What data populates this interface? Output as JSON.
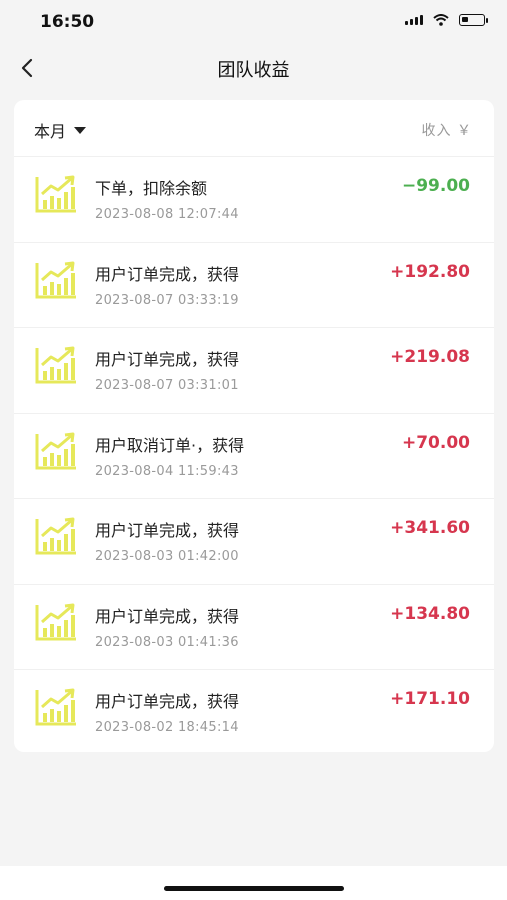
{
  "status": {
    "time": "16:50"
  },
  "nav": {
    "title": "团队收益"
  },
  "filter": {
    "label": "本月"
  },
  "header": {
    "income_label": "收入 ￥"
  },
  "colors": {
    "negative": "#4caf50",
    "positive": "#d6364e",
    "icon": "#e6e85a"
  },
  "rows": [
    {
      "title": "下单，扣除余额",
      "time": "2023-08-08 12:07:44",
      "amount": "−99.00",
      "sign": "negative"
    },
    {
      "title": "用户订单完成，获得",
      "time": "2023-08-07 03:33:19",
      "amount": "+192.80",
      "sign": "positive"
    },
    {
      "title": "用户订单完成，获得",
      "time": "2023-08-07 03:31:01",
      "amount": "+219.08",
      "sign": "positive"
    },
    {
      "title": "用户取消订单·，获得",
      "time": "2023-08-04 11:59:43",
      "amount": "+70.00",
      "sign": "positive"
    },
    {
      "title": "用户订单完成，获得",
      "time": "2023-08-03 01:42:00",
      "amount": "+341.60",
      "sign": "positive"
    },
    {
      "title": "用户订单完成，获得",
      "time": "2023-08-03 01:41:36",
      "amount": "+134.80",
      "sign": "positive"
    },
    {
      "title": "用户订单完成，获得",
      "time": "2023-08-02 18:45:14",
      "amount": "+171.10",
      "sign": "positive"
    }
  ]
}
